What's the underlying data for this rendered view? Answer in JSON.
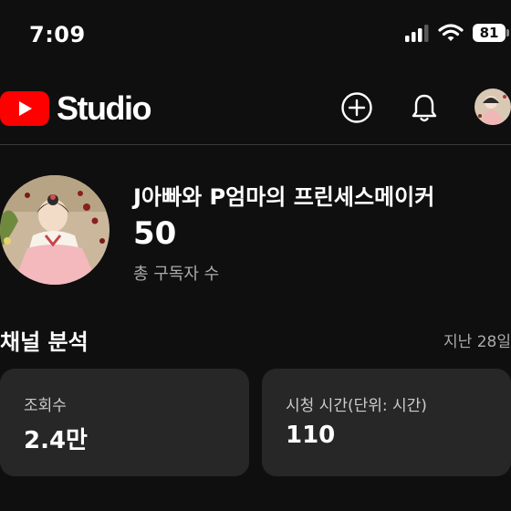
{
  "status_bar": {
    "time": "7:09",
    "battery": "81"
  },
  "header": {
    "logo_text": "Studio",
    "create_icon": "add-circle-icon",
    "notifications_icon": "bell-icon"
  },
  "channel": {
    "name": "J아빠와 P엄마의 프린세스메이커",
    "subscriber_count": "50",
    "subscriber_label": "총 구독자 수"
  },
  "analytics": {
    "title": "채널 분석",
    "period": "지난 28일",
    "cards": [
      {
        "label": "조회수",
        "value": "2.4만"
      },
      {
        "label": "시청 시간(단위: 시간)",
        "value": "110"
      }
    ]
  },
  "colors": {
    "background": "#0f0f0f",
    "card": "#272727",
    "youtube_red": "#ff0000",
    "secondary_text": "#aaaaaa"
  }
}
